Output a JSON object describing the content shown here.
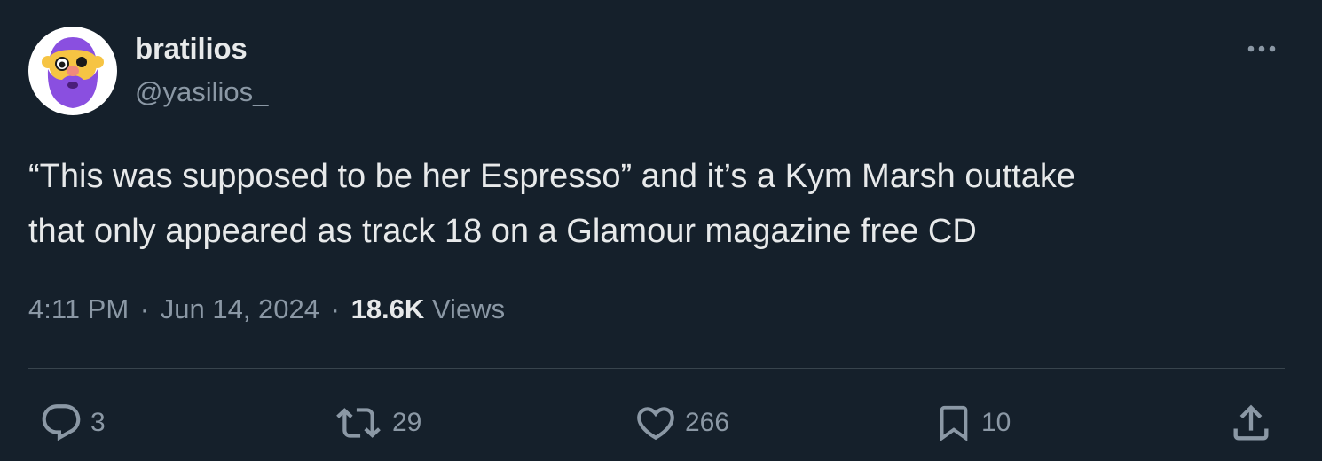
{
  "author": {
    "display_name": "bratilios",
    "handle": "@yasilios_"
  },
  "tweet": {
    "text": "“This was supposed to be her Espresso” and it’s a Kym Marsh outtake\nthat only appeared as track 18 on a Glamour magazine free CD"
  },
  "meta": {
    "time": "4:11 PM",
    "separator": "·",
    "date": "Jun 14, 2024",
    "views_count": "18.6K",
    "views_label": "Views"
  },
  "actions": {
    "reply": {
      "icon": "reply-icon",
      "count": "3"
    },
    "retweet": {
      "icon": "retweet-icon",
      "count": "29"
    },
    "like": {
      "icon": "heart-icon",
      "count": "266"
    },
    "bookmark": {
      "icon": "bookmark-icon",
      "count": "10"
    },
    "share": {
      "icon": "share-icon"
    }
  },
  "colors": {
    "background": "#15202b",
    "primary_text": "#e7e9ea",
    "secondary_text": "#8b98a5",
    "divider": "#38444d",
    "avatar_beard": "#8a4fe0",
    "avatar_face": "#f6c443"
  }
}
